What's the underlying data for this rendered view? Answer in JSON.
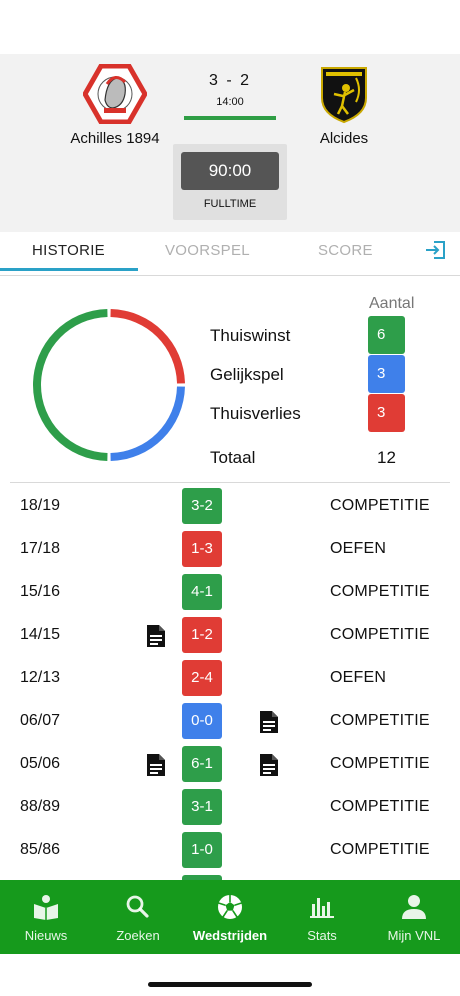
{
  "match": {
    "home_team": "Achilles 1894",
    "away_team": "Alcides",
    "score": "3 - 2",
    "kickoff": "14:00",
    "clock": "90:00",
    "period": "FULLTIME"
  },
  "tabs": [
    {
      "label": "HISTORIE",
      "active": true
    },
    {
      "label": "VOORSPEL",
      "active": false
    },
    {
      "label": "SCORE",
      "active": false
    }
  ],
  "summary": {
    "count_header": "Aantal",
    "stats": [
      {
        "label": "Thuiswinst",
        "value": 6,
        "color": "#2e9e4a"
      },
      {
        "label": "Gelijkspel",
        "value": 3,
        "color": "#3f80ea"
      },
      {
        "label": "Thuisverlies",
        "value": 3,
        "color": "#e03c35"
      }
    ],
    "total_label": "Totaal",
    "total_value": "12"
  },
  "colors": {
    "win": "#2e9e4a",
    "draw": "#3f80ea",
    "loss": "#e03c35",
    "nav_bg": "#169a1c",
    "tab_accent": "#2aa1c7"
  },
  "history": [
    {
      "season": "18/19",
      "result": "3-2",
      "outcome": "win",
      "type": "COMPETITIE",
      "doc_left": false,
      "doc_right": false
    },
    {
      "season": "17/18",
      "result": "1-3",
      "outcome": "loss",
      "type": "OEFEN",
      "doc_left": false,
      "doc_right": false
    },
    {
      "season": "15/16",
      "result": "4-1",
      "outcome": "win",
      "type": "COMPETITIE",
      "doc_left": false,
      "doc_right": false
    },
    {
      "season": "14/15",
      "result": "1-2",
      "outcome": "loss",
      "type": "COMPETITIE",
      "doc_left": true,
      "doc_right": false
    },
    {
      "season": "12/13",
      "result": "2-4",
      "outcome": "loss",
      "type": "OEFEN",
      "doc_left": false,
      "doc_right": false
    },
    {
      "season": "06/07",
      "result": "0-0",
      "outcome": "draw",
      "type": "COMPETITIE",
      "doc_left": false,
      "doc_right": true
    },
    {
      "season": "05/06",
      "result": "6-1",
      "outcome": "win",
      "type": "COMPETITIE",
      "doc_left": true,
      "doc_right": true
    },
    {
      "season": "88/89",
      "result": "3-1",
      "outcome": "win",
      "type": "COMPETITIE",
      "doc_left": false,
      "doc_right": false
    },
    {
      "season": "85/86",
      "result": "1-0",
      "outcome": "win",
      "type": "COMPETITIE",
      "doc_left": false,
      "doc_right": false
    },
    {
      "season": "",
      "result": "",
      "outcome": "win",
      "type": "",
      "doc_left": false,
      "doc_right": false
    }
  ],
  "nav": [
    {
      "label": "Nieuws",
      "icon": "news-icon",
      "active": false
    },
    {
      "label": "Zoeken",
      "icon": "search-icon",
      "active": false
    },
    {
      "label": "Wedstrijden",
      "icon": "soccer-ball-icon",
      "active": true
    },
    {
      "label": "Stats",
      "icon": "bar-chart-icon",
      "active": false
    },
    {
      "label": "Mijn VNL",
      "icon": "person-icon",
      "active": false
    }
  ]
}
